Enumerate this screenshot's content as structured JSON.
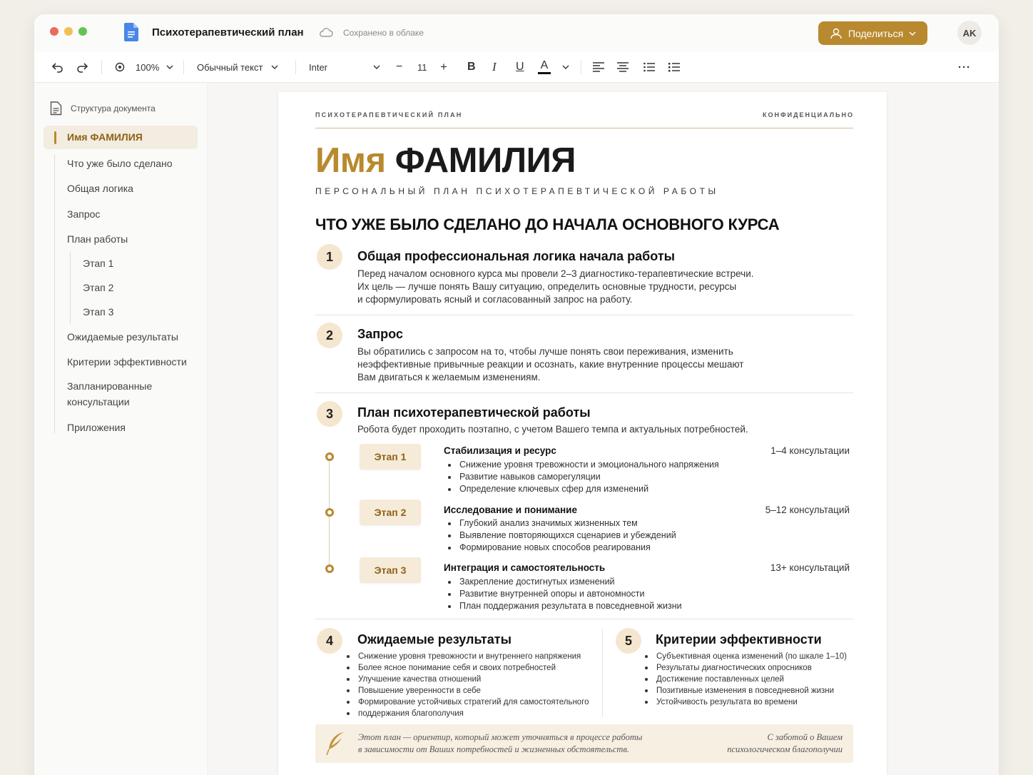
{
  "window": {
    "doc_title": "Психотерапевтический план",
    "saved_status": "Сохранено в облаке",
    "share_label": "Поделиться",
    "avatar_initials": "AK"
  },
  "toolbar": {
    "zoom": "100%",
    "style": "Обычный текст",
    "font": "Inter",
    "font_size": "11",
    "minus": "−",
    "plus": "+",
    "bold": "B",
    "italic": "I",
    "underline": "U",
    "color": "A",
    "more": "···"
  },
  "sidebar": {
    "header": "Структура документа",
    "items": [
      {
        "label": "Имя ФАМИЛИЯ"
      },
      {
        "label": "Что уже было сделано"
      },
      {
        "label": "Общая логика"
      },
      {
        "label": "Запрос"
      },
      {
        "label": "План работы"
      },
      {
        "label": "Этап 1"
      },
      {
        "label": "Этап 2"
      },
      {
        "label": "Этап 3"
      },
      {
        "label": "Ожидаемые результаты"
      },
      {
        "label": "Критерии эффективности"
      },
      {
        "label": "Запланированные консультации"
      },
      {
        "label": "Приложения"
      }
    ]
  },
  "doc": {
    "header_left": "ПСИХОТЕРАПЕВТИЧЕСКИЙ ПЛАН",
    "header_right": "КОНФИДЕНЦИАЛЬНО",
    "first_name": "Имя",
    "last_name": "ФАМИЛИЯ",
    "subtitle": "ПЕРСОНАЛЬНЫЙ ПЛАН ПСИХОТЕРАПЕВТИЧЕСКОЙ РАБОТЫ",
    "main_heading": "ЧТО УЖЕ БЫЛО СДЕЛАНО ДО НАЧАЛА ОСНОВНОГО КУРСА",
    "sections": [
      {
        "num": "1",
        "title": "Общая профессиональная логика начала работы",
        "lines": [
          "Перед началом основного курса мы провели 2–3 диагностико-терапевтические встречи.",
          "Их цель — лучше понять Вашу ситуацию, определить основные трудности, ресурсы",
          "и сформулировать ясный и согласованный запрос на работу."
        ]
      },
      {
        "num": "2",
        "title": "Запрос",
        "lines": [
          "Вы обратились с запросом на то, чтобы лучше понять свои переживания, изменить",
          "неэффективные привычные реакции и осознать, какие внутренние процессы мешают",
          "Вам двигаться к желаемым изменениям."
        ]
      },
      {
        "num": "3",
        "title": "План психотерапевтической работы",
        "lines": [
          "Робота будет проходить поэтапно, с учетом Вашего темпа и актуальных потребностей."
        ]
      }
    ],
    "stages": [
      {
        "label": "Этап 1",
        "title": "Стабилизация и ресурс",
        "count": "1–4 консультации",
        "bullets": [
          "Снижение уровня тревожности и эмоционального напряжения",
          "Развитие навыков саморегуляции",
          "Определение ключевых сфер для изменений"
        ]
      },
      {
        "label": "Этап 2",
        "title": "Исследование и понимание",
        "count": "5–12 консультаций",
        "bullets": [
          "Глубокий анализ значимых жизненных тем",
          "Выявление повторяющихся сценариев и убеждений",
          "Формирование новых способов реагирования"
        ]
      },
      {
        "label": "Этап 3",
        "title": "Интеграция и самостоятельность",
        "count": "13+ консультаций",
        "bullets": [
          "Закрепление достигнутых изменений",
          "Развитие внутренней опоры и автономности",
          "План поддержания результата в повседневной жизни"
        ]
      }
    ],
    "results": {
      "num": "4",
      "title": "Ожидаемые результаты",
      "bullets": [
        "Снижение уровня тревожности и внутреннего напряжения",
        "Более ясное понимание себя и своих потребностей",
        "Улучшение качества отношений",
        "Повышение уверенности в себе",
        "Формирование устойчивых стратегий для самостоятельного",
        "поддержания благополучия"
      ]
    },
    "criteria": {
      "num": "5",
      "title": "Критерии эффективности",
      "bullets": [
        "Субъективная оценка изменений (по шкале 1–10)",
        "Результаты диагностических опросников",
        "Достижение поставленных целей",
        "Позитивные изменения в повседневной жизни",
        "Устойчивость результата во времени"
      ]
    },
    "footer": {
      "left_1": "Этот план — ориентир, который может уточняться в процессе работы",
      "left_2": "в зависимости от Ваших потребностей и жизненных обстоятельств.",
      "right_1": "С заботой о Вашем",
      "right_2": "психологическом благополучии"
    }
  },
  "colors": {
    "accent": "#b8892e",
    "accent_soft": "#f5e6cf",
    "stage_bg": "#f6ead8",
    "footer_bg": "#f7efe2"
  }
}
